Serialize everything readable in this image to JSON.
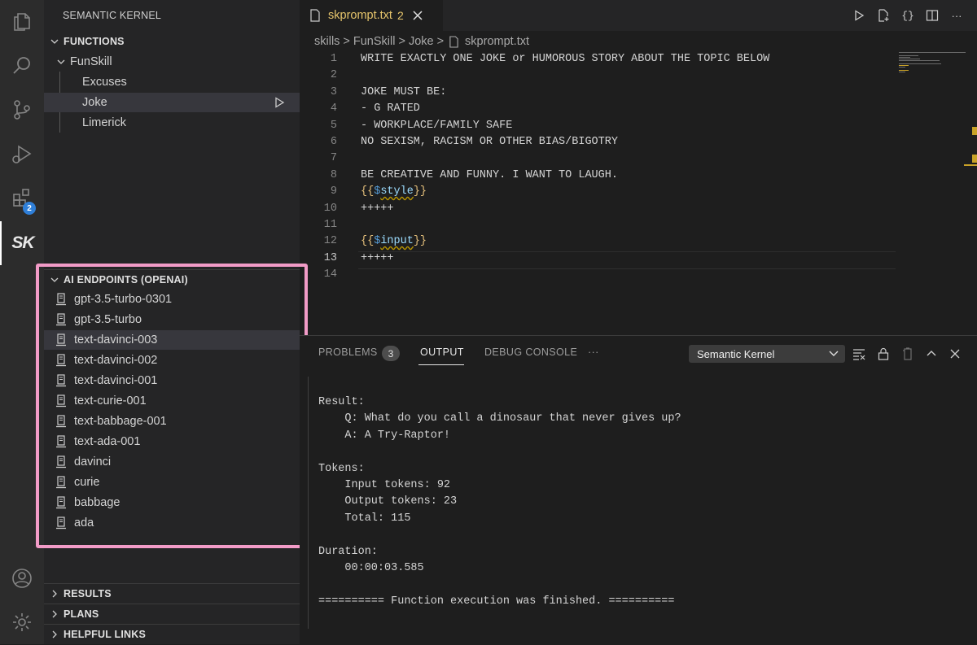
{
  "sidebar": {
    "title": "SEMANTIC KERNEL",
    "functions": {
      "header": "FUNCTIONS",
      "skill": "FunSkill",
      "items": [
        "Excuses",
        "Joke",
        "Limerick"
      ]
    },
    "endpoints": {
      "header": "AI ENDPOINTS (OPENAI)",
      "items": [
        "gpt-3.5-turbo-0301",
        "gpt-3.5-turbo",
        "text-davinci-003",
        "text-davinci-002",
        "text-davinci-001",
        "text-curie-001",
        "text-babbage-001",
        "text-ada-001",
        "davinci",
        "curie",
        "babbage",
        "ada"
      ]
    },
    "results_header": "RESULTS",
    "plans_header": "PLANS",
    "links_header": "HELPFUL LINKS"
  },
  "activity": {
    "extensions_badge": "2",
    "sk_logo": "SK"
  },
  "tab": {
    "name": "skprompt.txt",
    "problems": "2"
  },
  "breadcrumb": [
    "skills",
    "FunSkill",
    "Joke",
    "skprompt.txt"
  ],
  "editor": {
    "lines": [
      "WRITE EXACTLY ONE JOKE or HUMOROUS STORY ABOUT THE TOPIC BELOW",
      "",
      "JOKE MUST BE:",
      "- G RATED",
      "- WORKPLACE/FAMILY SAFE",
      "NO SEXISM, RACISM OR OTHER BIAS/BIGOTRY",
      "",
      "BE CREATIVE AND FUNNY. I WANT TO LAUGH.",
      "{{$style}}",
      "+++++",
      "",
      "{{$input}}",
      "+++++",
      ""
    ],
    "line_numbers": [
      "1",
      "2",
      "3",
      "4",
      "5",
      "6",
      "7",
      "8",
      "9",
      "10",
      "11",
      "12",
      "13",
      "14"
    ],
    "var_style": "style",
    "var_input": "input"
  },
  "panel": {
    "tabs": {
      "problems": "PROBLEMS",
      "output": "OUTPUT",
      "debug": "DEBUG CONSOLE",
      "more": "···"
    },
    "problems_count": "3",
    "output_channel": "Semantic Kernel",
    "output_lines": [
      "Result:",
      "    Q: What do you call a dinosaur that never gives up?",
      "    A: A Try-Raptor!",
      "",
      "Tokens:",
      "    Input tokens: 92",
      "    Output tokens: 23",
      "    Total: 115",
      "",
      "Duration:",
      "    00:00:03.585",
      "",
      "========== Function execution was finished. =========="
    ]
  },
  "colors": {
    "highlight": "#f29bc7",
    "accent": "#2f7fd8",
    "modified": "#e5c46b"
  }
}
